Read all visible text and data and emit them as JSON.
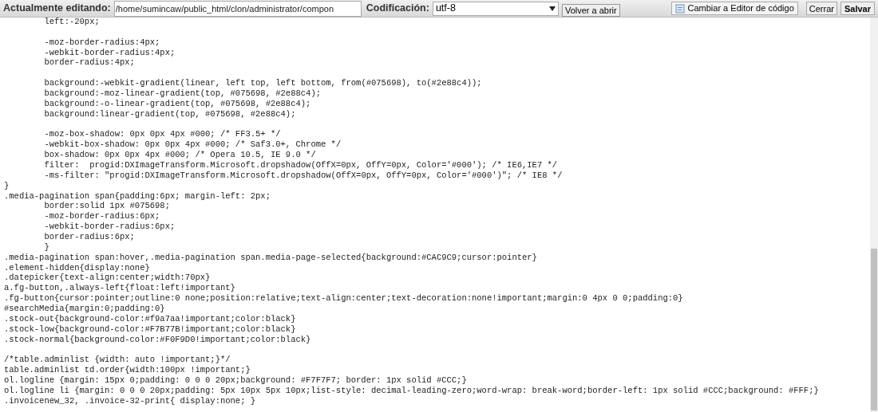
{
  "toolbar": {
    "editing_label": "Actualmente editando:",
    "path_value": "/home/sumincaw/public_html/clon/administrator/compon",
    "encoding_label": "Codificación:",
    "encoding_value": "utf-8",
    "reopen_button": "Volver a abrir",
    "switch_editor_button": "Cambiar a Editor de código",
    "close_button": "Cerrar",
    "save_button": "Salvar"
  },
  "code_lines": [
    "\tleft:-20px;",
    {
      "blank_before": true,
      "text": "\t-moz-border-radius:4px;"
    },
    "\t-webkit-border-radius:4px;",
    "\tborder-radius:4px;",
    {
      "blank_before": true,
      "text": "\tbackground:-webkit-gradient(linear, left top, left bottom, from(#075698), to(#2e88c4));"
    },
    "\tbackground:-moz-linear-gradient(top, #075698, #2e88c4);",
    "\tbackground:-o-linear-gradient(top, #075698, #2e88c4);",
    "\tbackground:linear-gradient(top, #075698, #2e88c4);",
    {
      "blank_before": true,
      "text": "\t-moz-box-shadow: 0px 0px 4px #000; /* FF3.5+ */"
    },
    "\t-webkit-box-shadow: 0px 0px 4px #000; /* Saf3.0+, Chrome */",
    "\tbox-shadow: 0px 0px 4px #000; /* Opera 10.5, IE 9.0 */",
    "\tfilter:  progid:DXImageTransform.Microsoft.dropshadow(OffX=0px, OffY=0px, Color='#000'); /* IE6,IE7 */",
    "\t-ms-filter: \"progid:DXImageTransform.Microsoft.dropshadow(OffX=0px, OffY=0px, Color='#000')\"; /* IE8 */",
    "}",
    ".media-pagination span{padding:6px; margin-left: 2px;",
    "\tborder:solid 1px #075698;",
    "\t-moz-border-radius:6px;",
    "\t-webkit-border-radius:6px;",
    "\tborder-radius:6px;",
    "\t}",
    ".media-pagination span:hover,.media-pagination span.media-page-selected{background:#CAC9C9;cursor:pointer}",
    ".element-hidden{display:none}",
    ".datepicker{text-align:center;width:70px}",
    "a.fg-button,.always-left{float:left!important}",
    ".fg-button{cursor:pointer;outline:0 none;position:relative;text-align:center;text-decoration:none!important;margin:0 4px 0 0;padding:0}",
    "#searchMedia{margin:0;padding:0}",
    ".stock-out{background-color:#f9a7aa!important;color:black}",
    ".stock-low{background-color:#F7B77B!important;color:black}",
    ".stock-normal{background-color:#F0F9D0!important;color:black}",
    {
      "blank_before": true,
      "text": "/*table.adminlist {width: auto !important;}*/"
    },
    "table.adminlist td.order{width:100px !important;}",
    "ol.logline {margin: 15px 0;padding: 0 0 0 20px;background: #F7F7F7; border: 1px solid #CCC;}",
    "ol.logline li {margin: 0 0 0 20px;padding: 5px 10px 5px 10px;list-style: decimal-leading-zero;word-wrap: break-word;border-left: 1px solid #CCC;background: #FFF;}",
    ".invoicenew_32, .invoice-32-print{ display:none; }"
  ]
}
